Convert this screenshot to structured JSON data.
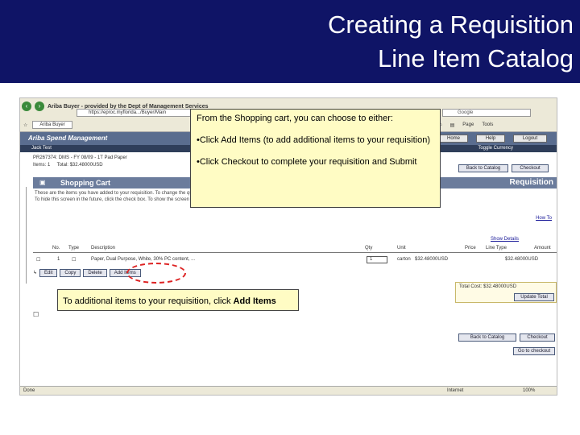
{
  "slide": {
    "title_line1": "Creating a Requisition",
    "title_line2": "Line Item Catalog"
  },
  "browser": {
    "window_title": "Ariba Buyer - provided by the Dept of Management Services",
    "address": "https://eproc.myflorida.../Buyer/Main",
    "search_placeholder": "Google",
    "tab_label": "Ariba Buyer",
    "tools": [
      "Page",
      "Tools"
    ]
  },
  "ariba": {
    "logo": "Ariba Spend Management",
    "buttons": [
      "Home",
      "Help",
      "Logout"
    ],
    "user": "Jack Test",
    "toggle_currency": "Toggle Currency",
    "req_line": "PR267374: DMS - FY 08/09 - 1T Pad Paper",
    "items_line": "Items: 1",
    "total_line": "Total: $32.48000USD"
  },
  "page": {
    "section_label": "Shopping Cart",
    "requisition_label": "Requisition",
    "back_to_catalog": "Back to Catalog",
    "checkout": "Checkout",
    "intro_1": "These are the items you have added to your requisition. To change the quantity, enter the new value. If you change any values, update the total.",
    "intro_2": "To hide this screen in the future, click the check box. To show the screen again, reset the default preference.",
    "how_to": "How To",
    "show_details": "Show Details",
    "update_total": "Update Total",
    "total_cost": "Total Cost: $32.48000USD",
    "go_to_checkout": "Go to checkout",
    "status_done": "Done",
    "status_zone": "Internet",
    "zoom": "100%"
  },
  "table": {
    "headers": [
      "No.",
      "Type",
      "Description",
      "Qty",
      "Unit",
      "Price",
      "Line Type",
      "Amount"
    ],
    "row": {
      "no": "1",
      "description": "Paper, Dual Purpose, White, 30% PC content, ...",
      "qty": "1",
      "unit": "carton",
      "price": "$32.48000USD",
      "amount": "$32.48000USD"
    },
    "actions": [
      "Edit",
      "Copy",
      "Delete",
      "Add Items"
    ]
  },
  "callouts": {
    "top_line1": "From the Shopping cart, you can choose to either:",
    "top_line2": "•Click Add Items (to add additional items to your requisition)",
    "top_line3": "•Click Checkout to complete your requisition and Submit",
    "bottom_prefix": "To additional items to your requisition, click",
    "bottom_bold": "Add Items"
  },
  "colors": {
    "header_bg": "#0f1466",
    "callout_bg": "#fffcc4",
    "ariba_bar": "#5a6d8f",
    "highlight_circle": "#dd2222"
  }
}
